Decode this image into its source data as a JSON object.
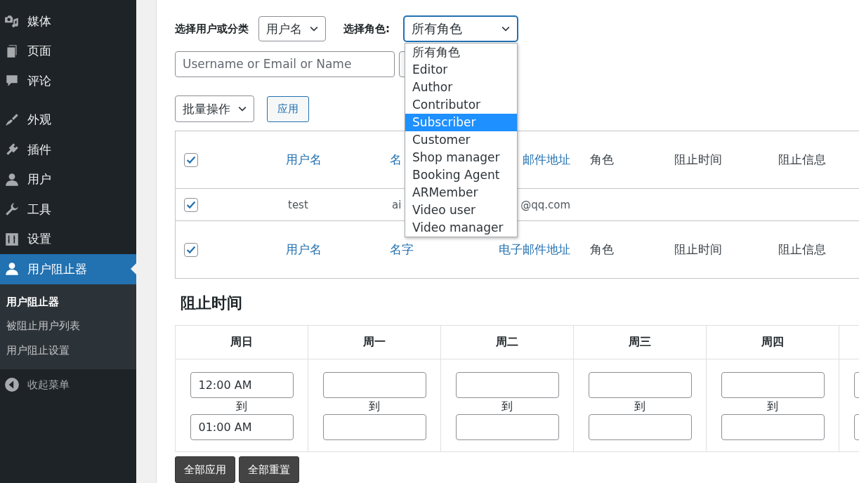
{
  "sidebar": {
    "items": [
      {
        "label": "媒体",
        "selected": false
      },
      {
        "label": "页面",
        "selected": false
      },
      {
        "label": "评论",
        "selected": false
      },
      {
        "label": "外观",
        "selected": false
      },
      {
        "label": "插件",
        "selected": false
      },
      {
        "label": "用户",
        "selected": false
      },
      {
        "label": "工具",
        "selected": false
      },
      {
        "label": "设置",
        "selected": false
      },
      {
        "label": "用户阻止器",
        "selected": true,
        "children": [
          {
            "label": "用户阻止器",
            "selected": true
          },
          {
            "label": "被阻止用户列表",
            "selected": false
          },
          {
            "label": "用户阻止设置",
            "selected": false
          }
        ]
      }
    ],
    "collapse": "收起菜单"
  },
  "filters": {
    "user_label": "选择用户或分类",
    "user_select": "用户名",
    "role_label": "选择角色:",
    "role_select": "所有角色",
    "search": {
      "placeholder": "Username or Email or Name"
    },
    "role_options": [
      {
        "label": "所有角色",
        "selected": false
      },
      {
        "label": "Editor",
        "selected": false
      },
      {
        "label": "Author",
        "selected": false
      },
      {
        "label": "Contributor",
        "selected": false
      },
      {
        "label": "Subscriber",
        "selected": true
      },
      {
        "label": "Customer",
        "selected": false
      },
      {
        "label": "Shop manager",
        "selected": false
      },
      {
        "label": "Booking Agent",
        "selected": false
      },
      {
        "label": "ARMember",
        "selected": false
      },
      {
        "label": "Video user",
        "selected": false
      },
      {
        "label": "Video manager",
        "selected": false
      }
    ]
  },
  "bulk": {
    "select": "批量操作",
    "apply": "应用"
  },
  "table": {
    "rows": [
      {
        "kind": "head",
        "checked": true,
        "cells": [
          "用户名",
          "名",
          "邮件地址",
          "角色",
          "阻止时间",
          "阻止信息"
        ]
      },
      {
        "kind": "data",
        "checked": true,
        "cells": [
          "test",
          "ai",
          "@qq.com"
        ]
      },
      {
        "kind": "head",
        "checked": true,
        "cells": [
          "用户名",
          "名字",
          "电子邮件地址",
          "角色",
          "阻止时间",
          "阻止信息"
        ]
      }
    ]
  },
  "schedule": {
    "title": "阻止时间",
    "days": [
      {
        "kind": "day",
        "label": "周日",
        "from": "12:00 AM",
        "separator": "到",
        "to": "01:00 AM"
      },
      {
        "kind": "day",
        "label": "周一",
        "separator": "到"
      },
      {
        "kind": "day",
        "label": "周二",
        "separator": "到"
      },
      {
        "kind": "day",
        "label": "周三",
        "separator": "到"
      },
      {
        "kind": "day",
        "label": "周四",
        "separator": "到"
      },
      {
        "kind": "cut"
      }
    ],
    "buttons": [
      "全部应用",
      "全部重置"
    ]
  }
}
